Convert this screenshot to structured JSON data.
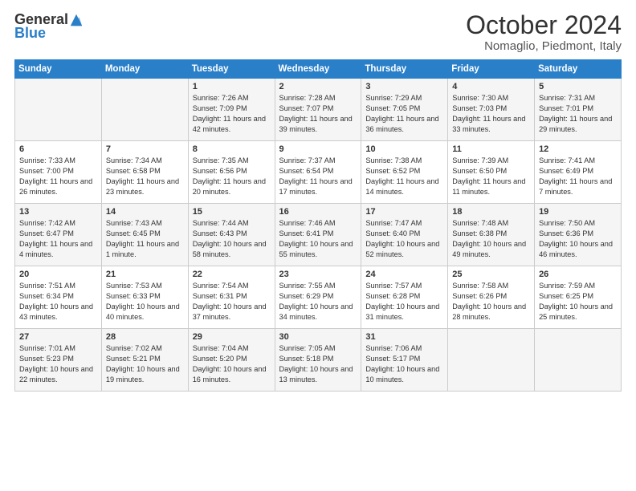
{
  "header": {
    "logo_general": "General",
    "logo_blue": "Blue",
    "month_title": "October 2024",
    "location": "Nomaglio, Piedmont, Italy"
  },
  "days_of_week": [
    "Sunday",
    "Monday",
    "Tuesday",
    "Wednesday",
    "Thursday",
    "Friday",
    "Saturday"
  ],
  "weeks": [
    [
      {
        "day": "",
        "sunrise": "",
        "sunset": "",
        "daylight": ""
      },
      {
        "day": "",
        "sunrise": "",
        "sunset": "",
        "daylight": ""
      },
      {
        "day": "1",
        "sunrise": "Sunrise: 7:26 AM",
        "sunset": "Sunset: 7:09 PM",
        "daylight": "Daylight: 11 hours and 42 minutes."
      },
      {
        "day": "2",
        "sunrise": "Sunrise: 7:28 AM",
        "sunset": "Sunset: 7:07 PM",
        "daylight": "Daylight: 11 hours and 39 minutes."
      },
      {
        "day": "3",
        "sunrise": "Sunrise: 7:29 AM",
        "sunset": "Sunset: 7:05 PM",
        "daylight": "Daylight: 11 hours and 36 minutes."
      },
      {
        "day": "4",
        "sunrise": "Sunrise: 7:30 AM",
        "sunset": "Sunset: 7:03 PM",
        "daylight": "Daylight: 11 hours and 33 minutes."
      },
      {
        "day": "5",
        "sunrise": "Sunrise: 7:31 AM",
        "sunset": "Sunset: 7:01 PM",
        "daylight": "Daylight: 11 hours and 29 minutes."
      }
    ],
    [
      {
        "day": "6",
        "sunrise": "Sunrise: 7:33 AM",
        "sunset": "Sunset: 7:00 PM",
        "daylight": "Daylight: 11 hours and 26 minutes."
      },
      {
        "day": "7",
        "sunrise": "Sunrise: 7:34 AM",
        "sunset": "Sunset: 6:58 PM",
        "daylight": "Daylight: 11 hours and 23 minutes."
      },
      {
        "day": "8",
        "sunrise": "Sunrise: 7:35 AM",
        "sunset": "Sunset: 6:56 PM",
        "daylight": "Daylight: 11 hours and 20 minutes."
      },
      {
        "day": "9",
        "sunrise": "Sunrise: 7:37 AM",
        "sunset": "Sunset: 6:54 PM",
        "daylight": "Daylight: 11 hours and 17 minutes."
      },
      {
        "day": "10",
        "sunrise": "Sunrise: 7:38 AM",
        "sunset": "Sunset: 6:52 PM",
        "daylight": "Daylight: 11 hours and 14 minutes."
      },
      {
        "day": "11",
        "sunrise": "Sunrise: 7:39 AM",
        "sunset": "Sunset: 6:50 PM",
        "daylight": "Daylight: 11 hours and 11 minutes."
      },
      {
        "day": "12",
        "sunrise": "Sunrise: 7:41 AM",
        "sunset": "Sunset: 6:49 PM",
        "daylight": "Daylight: 11 hours and 7 minutes."
      }
    ],
    [
      {
        "day": "13",
        "sunrise": "Sunrise: 7:42 AM",
        "sunset": "Sunset: 6:47 PM",
        "daylight": "Daylight: 11 hours and 4 minutes."
      },
      {
        "day": "14",
        "sunrise": "Sunrise: 7:43 AM",
        "sunset": "Sunset: 6:45 PM",
        "daylight": "Daylight: 11 hours and 1 minute."
      },
      {
        "day": "15",
        "sunrise": "Sunrise: 7:44 AM",
        "sunset": "Sunset: 6:43 PM",
        "daylight": "Daylight: 10 hours and 58 minutes."
      },
      {
        "day": "16",
        "sunrise": "Sunrise: 7:46 AM",
        "sunset": "Sunset: 6:41 PM",
        "daylight": "Daylight: 10 hours and 55 minutes."
      },
      {
        "day": "17",
        "sunrise": "Sunrise: 7:47 AM",
        "sunset": "Sunset: 6:40 PM",
        "daylight": "Daylight: 10 hours and 52 minutes."
      },
      {
        "day": "18",
        "sunrise": "Sunrise: 7:48 AM",
        "sunset": "Sunset: 6:38 PM",
        "daylight": "Daylight: 10 hours and 49 minutes."
      },
      {
        "day": "19",
        "sunrise": "Sunrise: 7:50 AM",
        "sunset": "Sunset: 6:36 PM",
        "daylight": "Daylight: 10 hours and 46 minutes."
      }
    ],
    [
      {
        "day": "20",
        "sunrise": "Sunrise: 7:51 AM",
        "sunset": "Sunset: 6:34 PM",
        "daylight": "Daylight: 10 hours and 43 minutes."
      },
      {
        "day": "21",
        "sunrise": "Sunrise: 7:53 AM",
        "sunset": "Sunset: 6:33 PM",
        "daylight": "Daylight: 10 hours and 40 minutes."
      },
      {
        "day": "22",
        "sunrise": "Sunrise: 7:54 AM",
        "sunset": "Sunset: 6:31 PM",
        "daylight": "Daylight: 10 hours and 37 minutes."
      },
      {
        "day": "23",
        "sunrise": "Sunrise: 7:55 AM",
        "sunset": "Sunset: 6:29 PM",
        "daylight": "Daylight: 10 hours and 34 minutes."
      },
      {
        "day": "24",
        "sunrise": "Sunrise: 7:57 AM",
        "sunset": "Sunset: 6:28 PM",
        "daylight": "Daylight: 10 hours and 31 minutes."
      },
      {
        "day": "25",
        "sunrise": "Sunrise: 7:58 AM",
        "sunset": "Sunset: 6:26 PM",
        "daylight": "Daylight: 10 hours and 28 minutes."
      },
      {
        "day": "26",
        "sunrise": "Sunrise: 7:59 AM",
        "sunset": "Sunset: 6:25 PM",
        "daylight": "Daylight: 10 hours and 25 minutes."
      }
    ],
    [
      {
        "day": "27",
        "sunrise": "Sunrise: 7:01 AM",
        "sunset": "Sunset: 5:23 PM",
        "daylight": "Daylight: 10 hours and 22 minutes."
      },
      {
        "day": "28",
        "sunrise": "Sunrise: 7:02 AM",
        "sunset": "Sunset: 5:21 PM",
        "daylight": "Daylight: 10 hours and 19 minutes."
      },
      {
        "day": "29",
        "sunrise": "Sunrise: 7:04 AM",
        "sunset": "Sunset: 5:20 PM",
        "daylight": "Daylight: 10 hours and 16 minutes."
      },
      {
        "day": "30",
        "sunrise": "Sunrise: 7:05 AM",
        "sunset": "Sunset: 5:18 PM",
        "daylight": "Daylight: 10 hours and 13 minutes."
      },
      {
        "day": "31",
        "sunrise": "Sunrise: 7:06 AM",
        "sunset": "Sunset: 5:17 PM",
        "daylight": "Daylight: 10 hours and 10 minutes."
      },
      {
        "day": "",
        "sunrise": "",
        "sunset": "",
        "daylight": ""
      },
      {
        "day": "",
        "sunrise": "",
        "sunset": "",
        "daylight": ""
      }
    ]
  ]
}
